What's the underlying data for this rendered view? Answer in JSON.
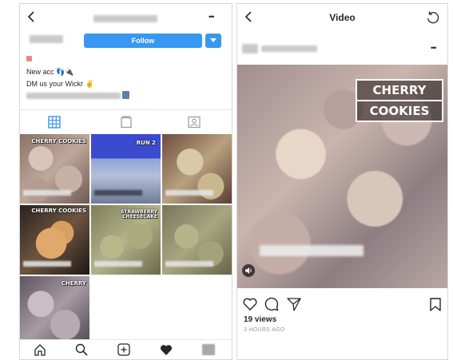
{
  "left_screen": {
    "header": {
      "username": "",
      "more_label": "•••"
    },
    "profile": {
      "follow_label": "Follow"
    },
    "bio": {
      "line1": "New acc 👣🔌",
      "line2": "DM us your Wickr ✌",
      "line3": ""
    },
    "tabs": [
      "grid-icon",
      "list-icon",
      "tagged-icon"
    ],
    "grid": [
      {
        "overlay": "CHERRY COOKIES"
      },
      {
        "overlay": "RUN 2"
      },
      {
        "overlay": ""
      },
      {
        "overlay": "CHERRY COOKIES"
      },
      {
        "overlay": "STRAWBERRY CHEESECAKE"
      },
      {
        "overlay": ""
      },
      {
        "overlay": "CHERRY"
      }
    ],
    "bottom_nav": [
      "home-icon",
      "search-icon",
      "add-icon",
      "heart-icon",
      "profile-icon"
    ]
  },
  "right_screen": {
    "header": {
      "title": "Video"
    },
    "post": {
      "username": "",
      "more_label": "•••",
      "video_overlay_line1": "CHERRY",
      "video_overlay_line2": "COOKIES",
      "views": "19 views",
      "time": "3 HOURS AGO"
    }
  },
  "colors": {
    "accent": "#3897f0",
    "text": "#262626",
    "muted": "#999999"
  }
}
